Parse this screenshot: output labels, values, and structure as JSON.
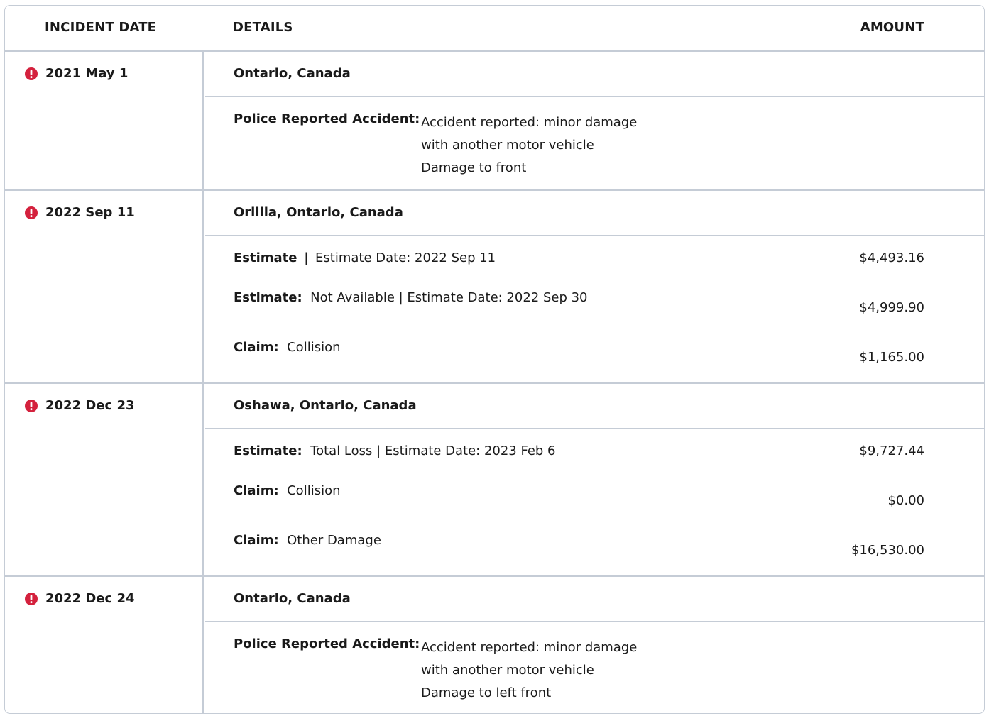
{
  "header": {
    "date_label": "INCIDENT DATE",
    "details_label": "DETAILS",
    "amount_label": "AMOUNT"
  },
  "colors": {
    "border": "#c5ccd6",
    "alert": "#d4213d"
  },
  "incidents": [
    {
      "date": "2021 May 1",
      "location": "Ontario, Canada",
      "report_label": "Police Reported Accident:",
      "report_lines": [
        "Accident reported: minor damage",
        "with another motor vehicle",
        "Damage to front"
      ]
    },
    {
      "date": "2022 Sep 11",
      "location": "Orillia, Ontario, Canada",
      "entries": [
        {
          "label": "Estimate",
          "text": "Estimate Date: 2022 Sep 11",
          "amount": "$4,493.16"
        },
        {
          "label": "Estimate:",
          "text": "Not Available | Estimate Date: 2022 Sep 30",
          "amount": "$4,999.90"
        },
        {
          "label": "Claim:",
          "text": "Collision",
          "amount": "$1,165.00"
        }
      ]
    },
    {
      "date": "2022 Dec 23",
      "location": "Oshawa, Ontario, Canada",
      "entries": [
        {
          "label": "Estimate:",
          "text": "Total Loss | Estimate Date: 2023 Feb 6",
          "amount": "$9,727.44"
        },
        {
          "label": "Claim:",
          "text": "Collision",
          "amount": "$0.00"
        },
        {
          "label": "Claim:",
          "text": "Other Damage",
          "amount": "$16,530.00"
        }
      ]
    },
    {
      "date": "2022 Dec 24",
      "location": "Ontario, Canada",
      "report_label": "Police Reported Accident:",
      "report_lines": [
        "Accident reported: minor damage",
        "with another motor vehicle",
        "Damage to left front"
      ]
    }
  ]
}
